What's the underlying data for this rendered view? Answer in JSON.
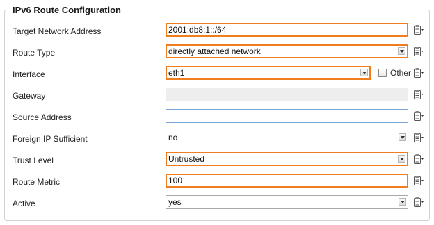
{
  "section": {
    "title": "IPv6 Route Configuration"
  },
  "rows": [
    {
      "label": "Target Network Address",
      "value": "2001:db8:1::/64",
      "control": "text",
      "highlighted": true
    },
    {
      "label": "Route Type",
      "value": "directly attached network",
      "control": "select",
      "highlighted": true
    },
    {
      "label": "Interface",
      "value": "eth1",
      "control": "select",
      "highlighted": true
    },
    {
      "label": "Gateway",
      "value": "",
      "control": "text",
      "disabled": true
    },
    {
      "label": "Source Address",
      "value": "",
      "control": "text",
      "focused": true
    },
    {
      "label": "Foreign IP Sufficient",
      "value": "no",
      "control": "select"
    },
    {
      "label": "Trust Level",
      "value": "Untrusted",
      "control": "select",
      "highlighted": true
    },
    {
      "label": "Route Metric",
      "value": "100",
      "control": "text",
      "highlighted": true
    },
    {
      "label": "Active",
      "value": "yes",
      "control": "select"
    }
  ],
  "interface_other": {
    "label": "Other",
    "checked": false
  },
  "icons": {
    "row_menu": "clipboard-menu-icon",
    "dropdown": "chevron-down-icon",
    "checkbox": "checkbox-icon"
  },
  "colors": {
    "highlight": "#f07d1e",
    "focus": "#7aa7d6",
    "disabled_bg": "#eeeeee",
    "border": "#a9a9a9"
  }
}
